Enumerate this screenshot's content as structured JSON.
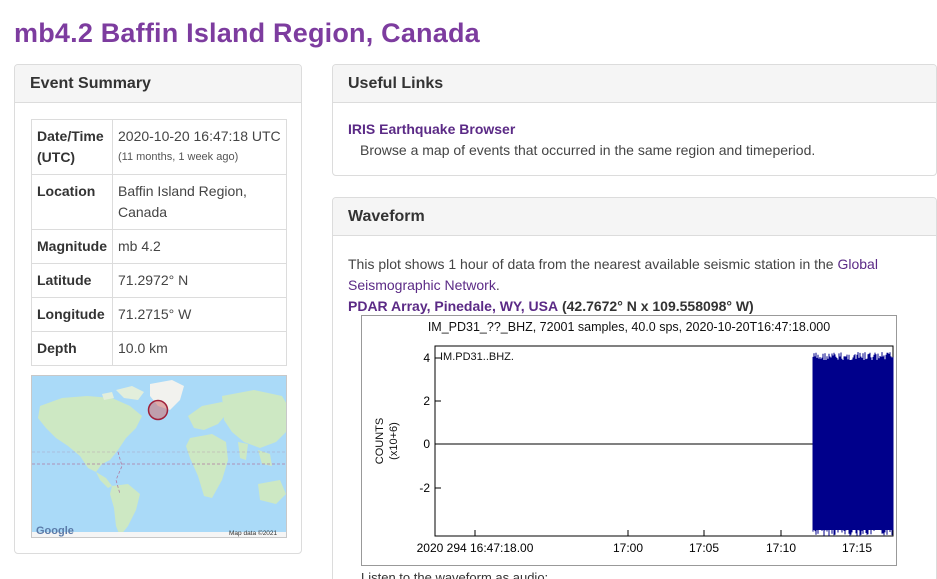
{
  "page": {
    "title": "mb4.2 Baffin Island Region, Canada"
  },
  "summary": {
    "heading": "Event Summary",
    "rows": [
      {
        "key": "Date/Time (UTC)",
        "value": "2020-10-20 16:47:18 UTC",
        "note": "(11 months, 1 week ago)"
      },
      {
        "key": "Location",
        "value": "Baffin Island Region, Canada"
      },
      {
        "key": "Magnitude",
        "value": "mb 4.2"
      },
      {
        "key": "Latitude",
        "value": "71.2972° N"
      },
      {
        "key": "Longitude",
        "value": "71.2715° W"
      },
      {
        "key": "Depth",
        "value": "10.0 km"
      }
    ],
    "map": {
      "logo": "Google",
      "attribution": "Map data ©2021"
    }
  },
  "links": {
    "heading": "Useful Links",
    "item_title": "IRIS Earthquake Browser",
    "item_desc": "Browse a map of events that occurred in the same region and timeperiod."
  },
  "waveform": {
    "heading": "Waveform",
    "text_before": "This plot shows 1 hour of data from the nearest available seismic station in the ",
    "network_link": "Global Seismographic Network",
    "text_after": ".",
    "station_link": "PDAR Array, Pinedale, WY, USA",
    "station_coords": "(42.7672° N x 109.558098° W)",
    "plot": {
      "title": "IM_PD31_??_BHZ, 72001 samples, 40.0 sps, 2020-10-20T16:47:18.000",
      "trace_label": "IM.PD31..BHZ.",
      "ylabel": "COUNTS",
      "yunit": "(x10+6)",
      "yticks": [
        "4",
        "2",
        "0",
        "-2"
      ],
      "xticks": [
        "2020 294 16:47:18.00",
        "17:00",
        "17:05",
        "17:10",
        "17:15"
      ],
      "trace_color": "#00008b"
    },
    "audio_label": "Listen to the waveform as audio:"
  }
}
